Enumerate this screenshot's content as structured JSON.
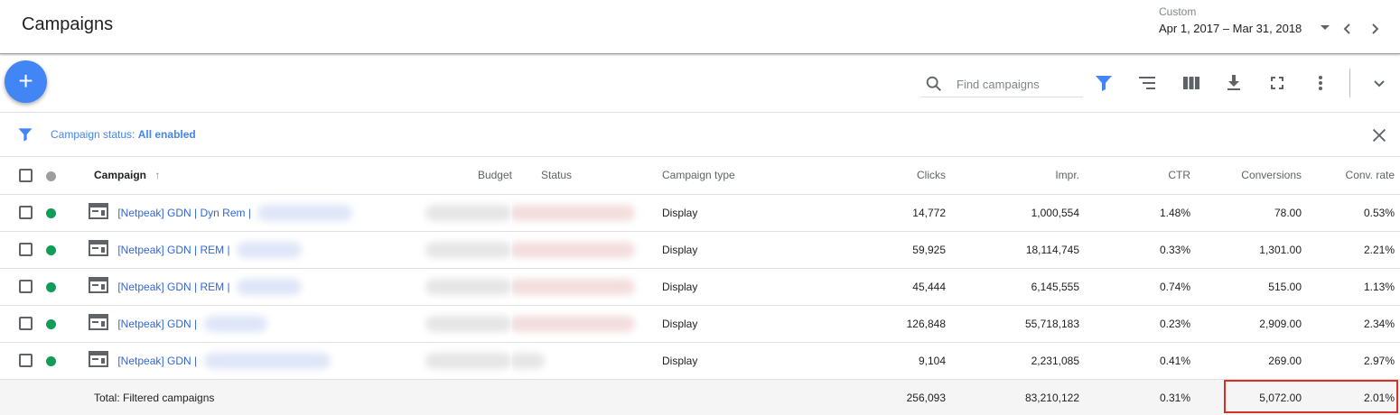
{
  "header": {
    "title": "Campaigns",
    "date_range_label": "Custom",
    "date_range_value": "Apr 1, 2017 – Mar 31, 2018"
  },
  "toolbar": {
    "add_button": "+",
    "search_placeholder": "Find campaigns",
    "icons": [
      "search-icon",
      "filter-icon",
      "segment-icon",
      "columns-icon",
      "download-icon",
      "fullscreen-icon",
      "more-vert-icon",
      "chevron-down-icon"
    ]
  },
  "filter": {
    "prefix": "Campaign status: ",
    "value": "All enabled"
  },
  "table": {
    "columns": {
      "campaign": "Campaign",
      "budget": "Budget",
      "status": "Status",
      "type": "Campaign type",
      "clicks": "Clicks",
      "impr": "Impr.",
      "ctr": "CTR",
      "conversions": "Conversions",
      "conv_rate": "Conv. rate"
    },
    "rows": [
      {
        "name": "[Netpeak] GDN | Dyn Rem |",
        "type": "Display",
        "clicks": "14,772",
        "impr": "1,000,554",
        "ctr": "1.48%",
        "conversions": "78.00",
        "conv_rate": "0.53%"
      },
      {
        "name": "[Netpeak] GDN | REM |",
        "type": "Display",
        "clicks": "59,925",
        "impr": "18,114,745",
        "ctr": "0.33%",
        "conversions": "1,301.00",
        "conv_rate": "2.21%"
      },
      {
        "name": "[Netpeak] GDN | REM |",
        "type": "Display",
        "clicks": "45,444",
        "impr": "6,145,555",
        "ctr": "0.74%",
        "conversions": "515.00",
        "conv_rate": "1.13%"
      },
      {
        "name": "[Netpeak] GDN |",
        "type": "Display",
        "clicks": "126,848",
        "impr": "55,718,183",
        "ctr": "0.23%",
        "conversions": "2,909.00",
        "conv_rate": "2.34%"
      },
      {
        "name": "[Netpeak] GDN |",
        "type": "Display",
        "clicks": "9,104",
        "impr": "2,231,085",
        "ctr": "0.41%",
        "conversions": "269.00",
        "conv_rate": "2.97%"
      }
    ],
    "total": {
      "label": "Total: Filtered campaigns",
      "clicks": "256,093",
      "impr": "83,210,122",
      "ctr": "0.31%",
      "conversions": "5,072.00",
      "conv_rate": "2.01%"
    }
  },
  "colors": {
    "accent": "#4285f4",
    "link": "#3367d6",
    "enabled": "#0f9d58",
    "header_dot": "#9e9e9e",
    "highlight": "#d93025"
  }
}
